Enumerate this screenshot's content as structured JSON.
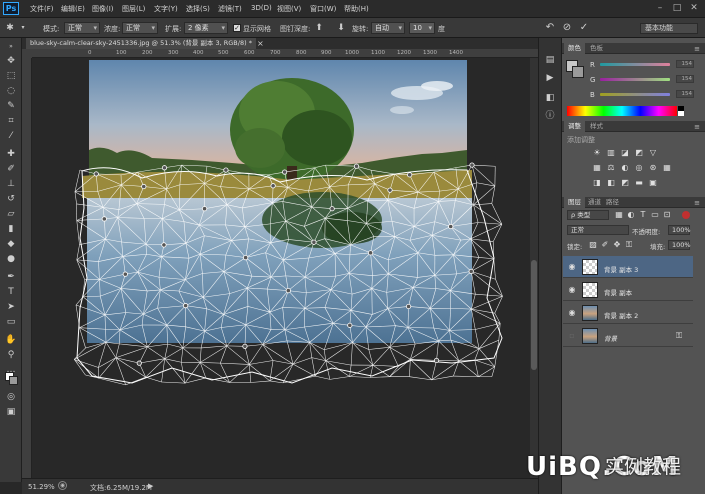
{
  "app": {
    "logo": "Ps",
    "menus": [
      "文件(F)",
      "编辑(E)",
      "图像(I)",
      "图层(L)",
      "文字(Y)",
      "选择(S)",
      "滤镜(T)",
      "3D(D)",
      "视图(V)",
      "窗口(W)",
      "帮助(H)"
    ],
    "window_buttons": [
      "–",
      "□",
      "✕"
    ]
  },
  "options_bar": {
    "mode_label": "模式:",
    "mode_value": "正常",
    "density_label": "浓度:",
    "density_value": "正常",
    "expand_label": "扩展:",
    "expand_value": "2 像素",
    "show_mesh_label": "显示网格",
    "pin_depth_label": "图钉深度:",
    "rotate_label": "旋转:",
    "rotate_value": "自动",
    "angle_value": "10",
    "angle_unit": "度",
    "workspace": "基本功能"
  },
  "document": {
    "tab_title": "blue-sky-calm-clear-sky-2451336.jpg @ 51.3% (背景 副本 3, RGB/8) *",
    "tab_close": "×",
    "ruler_ticks": [
      "0",
      "100",
      "200",
      "300",
      "400",
      "500",
      "600",
      "700",
      "800",
      "900",
      "1000",
      "1100",
      "1200",
      "1300",
      "1400"
    ],
    "zoom": "51.29%",
    "doc_info": "文档:6.25M/19.2M",
    "status_arrow": "▶"
  },
  "color_panel": {
    "tabs": [
      "颜色",
      "色板"
    ],
    "channels": [
      {
        "label": "R",
        "value": "154",
        "color": "#a08a7a"
      },
      {
        "label": "G",
        "value": "154",
        "color": "#8a9a7a"
      },
      {
        "label": "B",
        "value": "154",
        "color": "#7a8aa0"
      }
    ]
  },
  "adjustments_panel": {
    "tabs": [
      "调整",
      "样式"
    ],
    "title": "添加调整"
  },
  "layers_panel": {
    "tabs": [
      "图层",
      "通道",
      "路径"
    ],
    "filter_label": "ρ 类型",
    "blend_mode": "正常",
    "opacity_label": "不透明度:",
    "opacity_value": "100%",
    "lock_label": "锁定:",
    "fill_label": "填充:",
    "fill_value": "100%",
    "layers": [
      {
        "name": "背景 副本 3",
        "selected": true,
        "visible": true
      },
      {
        "name": "背景 副本",
        "selected": false,
        "visible": true
      },
      {
        "name": "背景 副本 2",
        "selected": false,
        "visible": true
      },
      {
        "name": "背景",
        "selected": false,
        "visible": false,
        "locked": true
      }
    ]
  },
  "watermark": {
    "logo_text": "UiBQ.CoM",
    "cn_text": "实例教程"
  }
}
